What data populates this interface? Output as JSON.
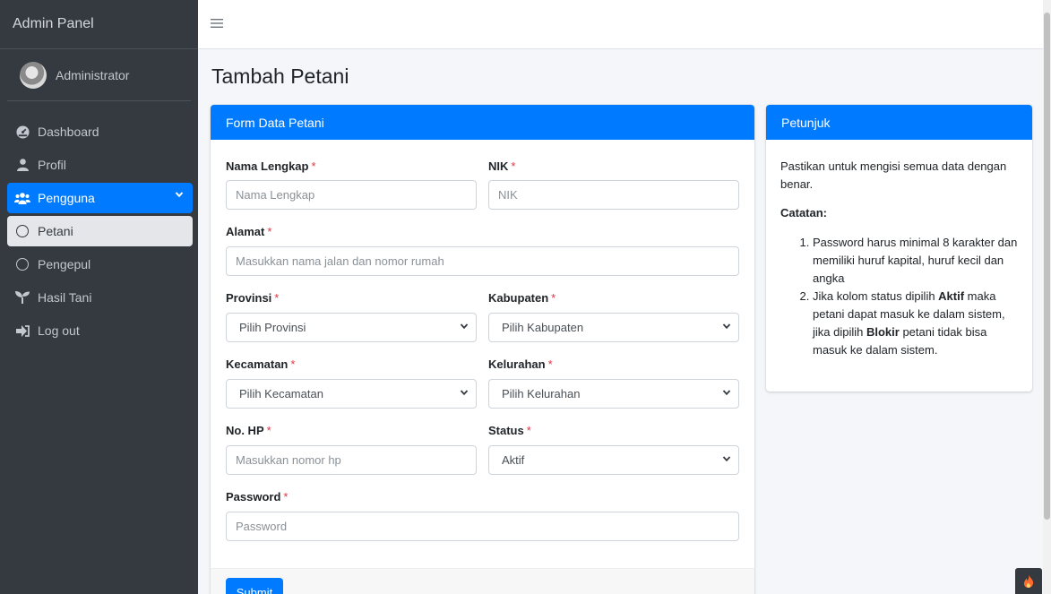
{
  "sidebar": {
    "brand": "Admin Panel",
    "user": "Administrator",
    "items": [
      {
        "label": "Dashboard",
        "icon": "tachometer-icon"
      },
      {
        "label": "Profil",
        "icon": "user-icon"
      },
      {
        "label": "Pengguna",
        "icon": "users-icon"
      },
      {
        "label": "Petani",
        "icon": "circle-icon"
      },
      {
        "label": "Pengepul",
        "icon": "circle-icon"
      },
      {
        "label": "Hasil Tani",
        "icon": "seedling-icon"
      },
      {
        "label": "Log out",
        "icon": "sign-out-icon"
      }
    ]
  },
  "page": {
    "title": "Tambah Petani"
  },
  "form": {
    "header": "Form Data Petani",
    "required_mark": "*",
    "nama": {
      "label": "Nama Lengkap",
      "placeholder": "Nama Lengkap"
    },
    "nik": {
      "label": "NIK",
      "placeholder": "NIK"
    },
    "alamat": {
      "label": "Alamat",
      "placeholder": "Masukkan nama jalan dan nomor rumah"
    },
    "provinsi": {
      "label": "Provinsi",
      "value": "Pilih Provinsi"
    },
    "kabupaten": {
      "label": "Kabupaten",
      "value": "Pilih Kabupaten"
    },
    "kecamatan": {
      "label": "Kecamatan",
      "value": "Pilih Kecamatan"
    },
    "kelurahan": {
      "label": "Kelurahan",
      "value": "Pilih Kelurahan"
    },
    "hp": {
      "label": "No. HP",
      "placeholder": "Masukkan nomor hp"
    },
    "status": {
      "label": "Status",
      "value": "Aktif"
    },
    "password": {
      "label": "Password",
      "placeholder": "Password"
    },
    "submit": "Submit"
  },
  "help": {
    "header": "Petunjuk",
    "intro": "Pastikan untuk mengisi semua data dengan benar.",
    "notes_title": "Catatan:",
    "note1": "Password harus minimal 8 karakter dan memiliki huruf kapital, huruf kecil dan angka",
    "note2_a": "Jika kolom status dipilih ",
    "note2_b": "Aktif",
    "note2_c": " maka petani dapat masuk ke dalam sistem, jika dipilih ",
    "note2_d": "Blokir",
    "note2_e": " petani tidak bisa masuk ke dalam sistem."
  },
  "colors": {
    "primary": "#007bff",
    "sidebar": "#343a40",
    "required": "#dc3545"
  }
}
